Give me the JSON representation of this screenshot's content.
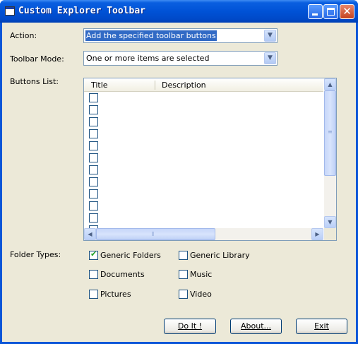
{
  "window": {
    "title": "Custom Explorer Toolbar"
  },
  "labels": {
    "action": "Action:",
    "toolbar_mode": "Toolbar Mode:",
    "buttons_list": "Buttons List:",
    "folder_types": "Folder Types:"
  },
  "action_combo": {
    "selected": "Add the specified toolbar buttons"
  },
  "mode_combo": {
    "selected": "One or more items are selected"
  },
  "buttons_list": {
    "columns": [
      "Title",
      "Description"
    ],
    "rows": [
      {
        "checked": false
      },
      {
        "checked": false
      },
      {
        "checked": false
      },
      {
        "checked": false
      },
      {
        "checked": false
      },
      {
        "checked": false
      },
      {
        "checked": false
      },
      {
        "checked": false
      },
      {
        "checked": false
      },
      {
        "checked": false
      },
      {
        "checked": false
      },
      {
        "checked": false
      }
    ]
  },
  "folder_types": [
    {
      "label": "Generic Folders",
      "checked": true
    },
    {
      "label": "Generic Library",
      "checked": false
    },
    {
      "label": "Documents",
      "checked": false
    },
    {
      "label": "Music",
      "checked": false
    },
    {
      "label": "Pictures",
      "checked": false
    },
    {
      "label": "Video",
      "checked": false
    }
  ],
  "buttons": {
    "doit": "Do It !",
    "about": "About...",
    "exit": "Exit"
  },
  "icons": {
    "close": "close-icon",
    "minimize": "minimize-icon",
    "maximize": "maximize-icon",
    "dropdown": "chevron-down-icon",
    "checkmark": "checkmark-icon"
  }
}
